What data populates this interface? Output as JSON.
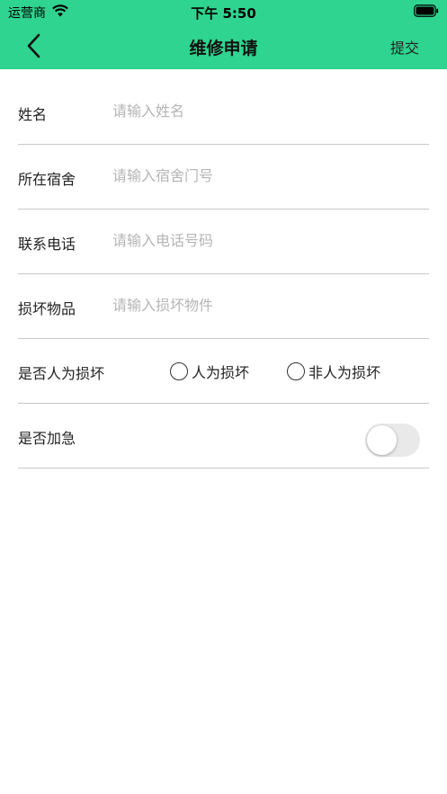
{
  "status_bar": {
    "carrier": "运营商",
    "time": "下午 5:50"
  },
  "nav": {
    "title": "维修申请",
    "submit_label": "提交"
  },
  "form": {
    "name": {
      "label": "姓名",
      "placeholder": "请输入姓名",
      "value": ""
    },
    "dorm": {
      "label": "所在宿舍",
      "placeholder": "请输入宿舍门号",
      "value": ""
    },
    "phone": {
      "label": "联系电话",
      "placeholder": "请输入电话号码",
      "value": ""
    },
    "item": {
      "label": "损坏物品",
      "placeholder": "请输入损坏物件",
      "value": ""
    },
    "damage_cause": {
      "label": "是否人为损坏",
      "options": [
        "人为损坏",
        "非人为损坏"
      ],
      "selected": null
    },
    "urgent": {
      "label": "是否加急",
      "on": false
    }
  },
  "colors": {
    "header_bg": "#2ed48f",
    "divider": "#c8c8c8",
    "placeholder": "#b5b5b5",
    "toggle_off": "#e9e9ea"
  },
  "icons": [
    "wifi-icon",
    "battery-icon",
    "chevron-left-icon"
  ]
}
